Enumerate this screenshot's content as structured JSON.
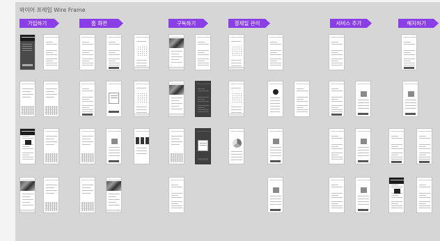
{
  "board": {
    "title": "와이어 프레임 Wire Frame",
    "banner_color": "#8a3ee6",
    "background": "#d6d6d6"
  },
  "sections": [
    {
      "key": "signup",
      "label": "가입하기"
    },
    {
      "key": "home",
      "label": "홈 화면"
    },
    {
      "key": "subscribe",
      "label": "구독하기"
    },
    {
      "key": "payment",
      "label": "결제일 관리"
    },
    {
      "key": "addon",
      "label": "서비스 추가"
    },
    {
      "key": "cancel",
      "label": "해지하기"
    }
  ]
}
